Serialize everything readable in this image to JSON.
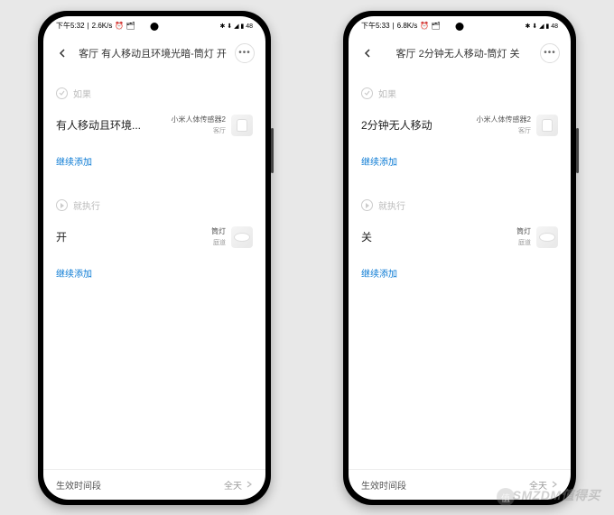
{
  "phones": [
    {
      "status": {
        "time": "下午5:32",
        "net": "2.6K/s",
        "icons": "⏰ 🗂",
        "right": "✱ ⬇ ◢ ▮ 48"
      },
      "header": {
        "title": "客厅 有人移动且环境光暗-筒灯 开"
      },
      "section_if": "如果",
      "condition": {
        "title": "有人移动且环境...",
        "device": "小米人体传感器2",
        "room": "客厅"
      },
      "add": "继续添加",
      "section_then": "就执行",
      "action": {
        "title": "开",
        "device": "筒灯",
        "room": "庭道"
      },
      "footer": {
        "label": "生效时间段",
        "value": "全天"
      }
    },
    {
      "status": {
        "time": "下午5:33",
        "net": "6.8K/s",
        "icons": "⏰ 🗂",
        "right": "✱ ⬇ ◢ ▮ 48"
      },
      "header": {
        "title": "客厅 2分钟无人移动-筒灯 关"
      },
      "section_if": "如果",
      "condition": {
        "title": "2分钟无人移动",
        "device": "小米人体传感器2",
        "room": "客厅"
      },
      "add": "继续添加",
      "section_then": "就执行",
      "action": {
        "title": "关",
        "device": "筒灯",
        "room": "庭道"
      },
      "footer": {
        "label": "生效时间段",
        "value": "全天"
      }
    }
  ],
  "watermark": "SMZDM值得买",
  "wm_badge": "值"
}
